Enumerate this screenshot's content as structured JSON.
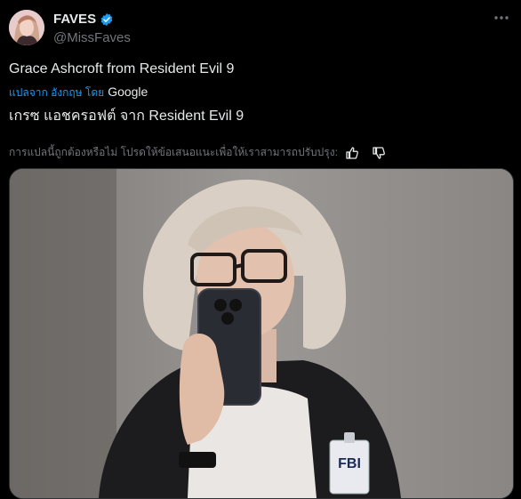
{
  "author": {
    "display_name": "FAVES",
    "handle": "@MissFaves",
    "verified": true
  },
  "post": {
    "text": "Grace Ashcroft from Resident Evil 9",
    "translated_from": "แปลจาก อังกฤษ โดย",
    "translator_brand": "Google",
    "translation": "เกรซ แอชครอฟต์ จาก Resident Evil 9",
    "feedback_prompt": "การแปลนี้ถูกต้องหรือไม่ โปรดให้ข้อเสนอแนะเพื่อให้เราสามารถปรับปรุง:"
  },
  "media": {
    "badge_text": "FBI"
  },
  "icons": {
    "more": "more-options-icon",
    "thumb_up": "thumbs-up-icon",
    "thumb_down": "thumbs-down-icon",
    "verified": "verified-badge-icon"
  },
  "colors": {
    "background": "#000000",
    "text": "#e7e9ea",
    "muted": "#71767b",
    "link": "#1d9bf0",
    "verified": "#1d9bf0"
  }
}
